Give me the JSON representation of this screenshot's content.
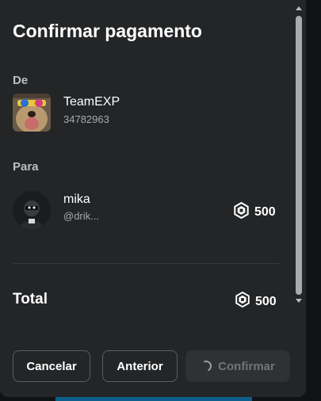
{
  "dialog": {
    "title": "Confirmar pagamento"
  },
  "from": {
    "label": "De",
    "name": "TeamEXP",
    "id": "34782963"
  },
  "to": {
    "label": "Para",
    "name": "mika",
    "handle": "@drik...",
    "amount": "500",
    "currency_icon": "robux-icon"
  },
  "total": {
    "label": "Total",
    "amount": "500",
    "currency_icon": "robux-icon"
  },
  "buttons": {
    "cancel": "Cancelar",
    "previous": "Anterior",
    "confirm": "Confirmar"
  },
  "colors": {
    "panel": "#232527",
    "divider": "#36383b",
    "muted_text": "#a8a9ab",
    "disabled_button": "#2f3134"
  }
}
